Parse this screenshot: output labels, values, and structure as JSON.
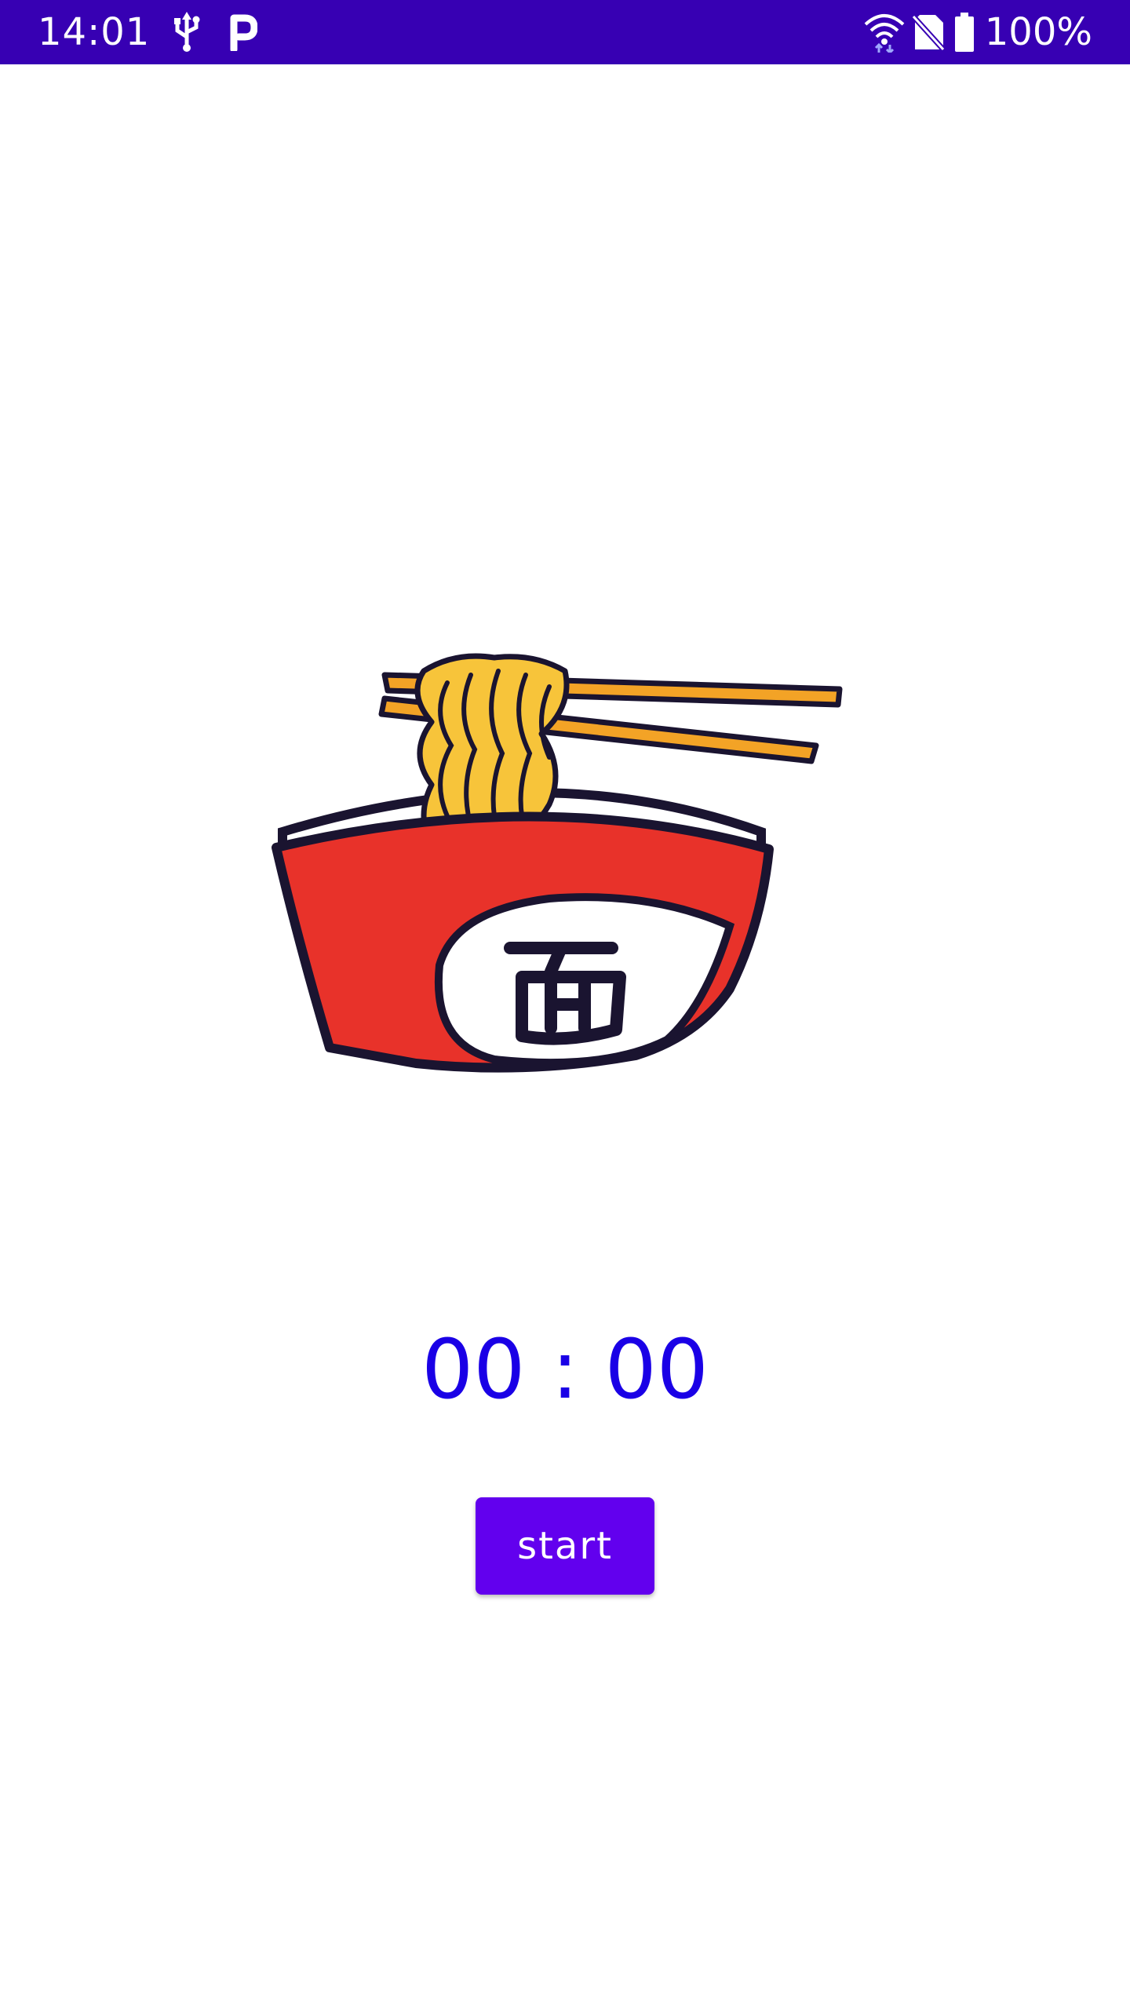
{
  "status_bar": {
    "time": "14:01",
    "battery_percent": "100%",
    "background_color": "#3700b3",
    "icons": [
      "usb-icon",
      "parking-icon",
      "wifi-icon",
      "no-sim-icon",
      "battery-icon"
    ]
  },
  "main": {
    "illustration": "noodle-bowl-icon",
    "timer_text": "00 : 00",
    "timer_color": "#1a00e6",
    "start_label": "start",
    "button_color": "#6200ee"
  }
}
